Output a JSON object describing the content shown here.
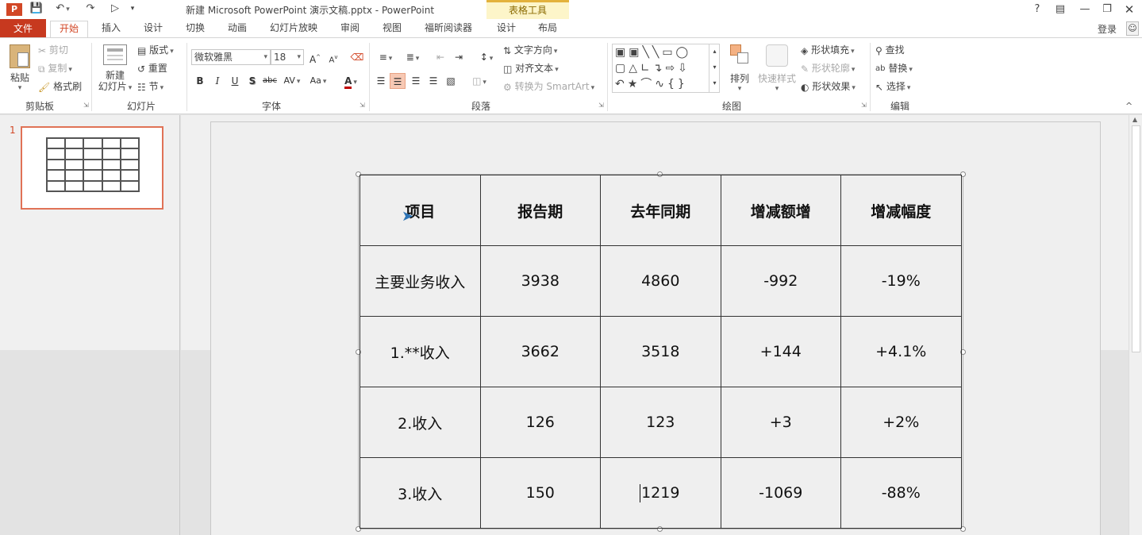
{
  "title_bar": {
    "title": "新建 Microsoft PowerPoint 演示文稿.pptx - PowerPoint",
    "contextual_group": "表格工具",
    "login": "登录"
  },
  "tabs": {
    "file": "文件",
    "items": [
      "开始",
      "插入",
      "设计",
      "切换",
      "动画",
      "幻灯片放映",
      "审阅",
      "视图",
      "福昕阅读器",
      "设计",
      "布局"
    ],
    "active": "开始"
  },
  "ribbon": {
    "clipboard": {
      "paste": "粘贴",
      "cut": "剪切",
      "copy": "复制",
      "format_painter": "格式刷",
      "label": "剪贴板"
    },
    "slides": {
      "new_slide_l1": "新建",
      "new_slide_l2": "幻灯片",
      "layout": "版式",
      "reset": "重置",
      "section": "节",
      "label": "幻灯片"
    },
    "font": {
      "font_name": "微软雅黑",
      "font_size": "18",
      "label": "字体"
    },
    "paragraph": {
      "text_direction": "文字方向",
      "align_text": "对齐文本",
      "convert_smartart": "转换为 SmartArt",
      "label": "段落"
    },
    "drawing": {
      "arrange": "排列",
      "quick_styles": "快速样式",
      "shape_fill": "形状填充",
      "shape_outline": "形状轮廓",
      "shape_effects": "形状效果",
      "label": "绘图"
    },
    "editing": {
      "find": "查找",
      "replace": "替换",
      "select": "选择",
      "label": "编辑"
    }
  },
  "thumbnails": {
    "slide_number": "1"
  },
  "table": {
    "header": [
      "项目",
      "报告期",
      "去年同期",
      "增减额增",
      "增减幅度"
    ],
    "rows": [
      [
        "主要业务收入",
        "3938",
        "4860",
        "-992",
        "-19%"
      ],
      [
        "1.**收入",
        "3662",
        "3518",
        "+144",
        "+4.1%"
      ],
      [
        "2.收入",
        "126",
        "123",
        "+3",
        "+2%"
      ],
      [
        "3.收入",
        "150",
        "1219",
        "-1069",
        "-88%"
      ]
    ]
  },
  "colors": {
    "accent": "#d24726",
    "file_tab": "#c7391f",
    "contextual_tab": "#fdf5c9"
  }
}
